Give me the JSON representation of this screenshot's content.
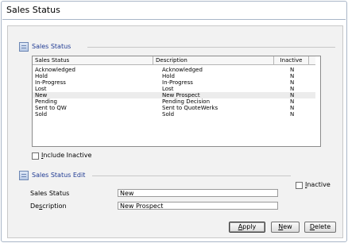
{
  "page": {
    "title": "Sales Status"
  },
  "list_section": {
    "title": "Sales Status",
    "columns": [
      "Sales Status",
      "Description",
      "Inactive"
    ],
    "rows": [
      {
        "status": "Acknowledged",
        "description": "Acknowledged",
        "inactive": "N"
      },
      {
        "status": "Hold",
        "description": "Hold",
        "inactive": "N"
      },
      {
        "status": "In-Progress",
        "description": "In-Progress",
        "inactive": "N"
      },
      {
        "status": "Lost",
        "description": "Lost",
        "inactive": "N"
      },
      {
        "status": "New",
        "description": "New Prospect",
        "inactive": "N"
      },
      {
        "status": "Pending",
        "description": "Pending Decision",
        "inactive": "N"
      },
      {
        "status": "Sent to QW",
        "description": "Sent to QuoteWerks",
        "inactive": "N"
      },
      {
        "status": "Sold",
        "description": "Sold",
        "inactive": "N"
      }
    ],
    "selected_row": "New",
    "include_inactive": {
      "pre": "",
      "key": "I",
      "post": "nclude Inactive",
      "checked": false
    }
  },
  "edit_section": {
    "title": "Sales Status Edit",
    "inactive": {
      "pre": "",
      "key": "I",
      "post": "nactive",
      "checked": false
    },
    "status_label": "Sales Status",
    "status_value": "New",
    "desc_label_pre": "De",
    "desc_label_key": "s",
    "desc_label_post": "cription",
    "desc_value": "New Prospect"
  },
  "buttons": {
    "apply": {
      "key": "A",
      "rest": "pply"
    },
    "new": {
      "key": "N",
      "rest": "ew"
    },
    "delete": {
      "key": "D",
      "rest": "elete"
    }
  },
  "colors": {
    "section_title": "#1f3a93",
    "border": "#a9b6c8"
  },
  "icons": {
    "section": "grid-icon"
  }
}
